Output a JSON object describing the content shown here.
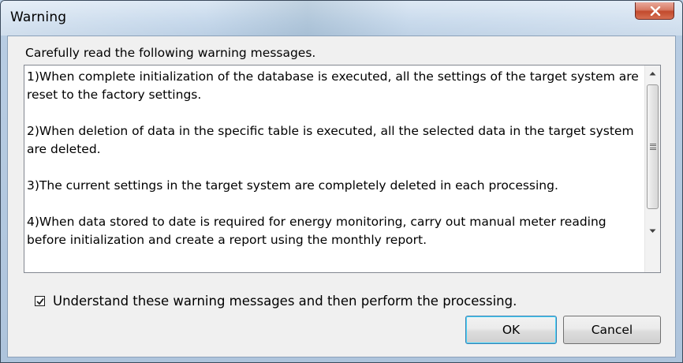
{
  "window": {
    "title": "Warning",
    "close_icon": "close-x-icon"
  },
  "instruction": "Carefully read the following warning messages.",
  "messages": [
    "1)When complete initialization of the database is executed, all the settings of the target system are reset to the factory settings.",
    "2)When deletion of data in the specific table is executed, all the selected data in the target system are deleted.",
    "3)The current settings in the target system are completely deleted in each processing.",
    "4)When data stored to date is required for energy monitoring, carry out manual meter reading before initialization and create a report using the monthly report."
  ],
  "scrollbar": {
    "up_icon": "scroll-up-arrow-icon",
    "down_icon": "scroll-down-arrow-icon",
    "thumb_icon": "scroll-grip-icon"
  },
  "confirm": {
    "checked": true,
    "label": "Understand these warning messages and then perform the processing."
  },
  "buttons": {
    "ok": "OK",
    "cancel": "Cancel"
  },
  "colors": {
    "close_button": "#c8492e",
    "dialog_background": "#f0f0f0",
    "default_button_border": "#3c7fb1"
  }
}
